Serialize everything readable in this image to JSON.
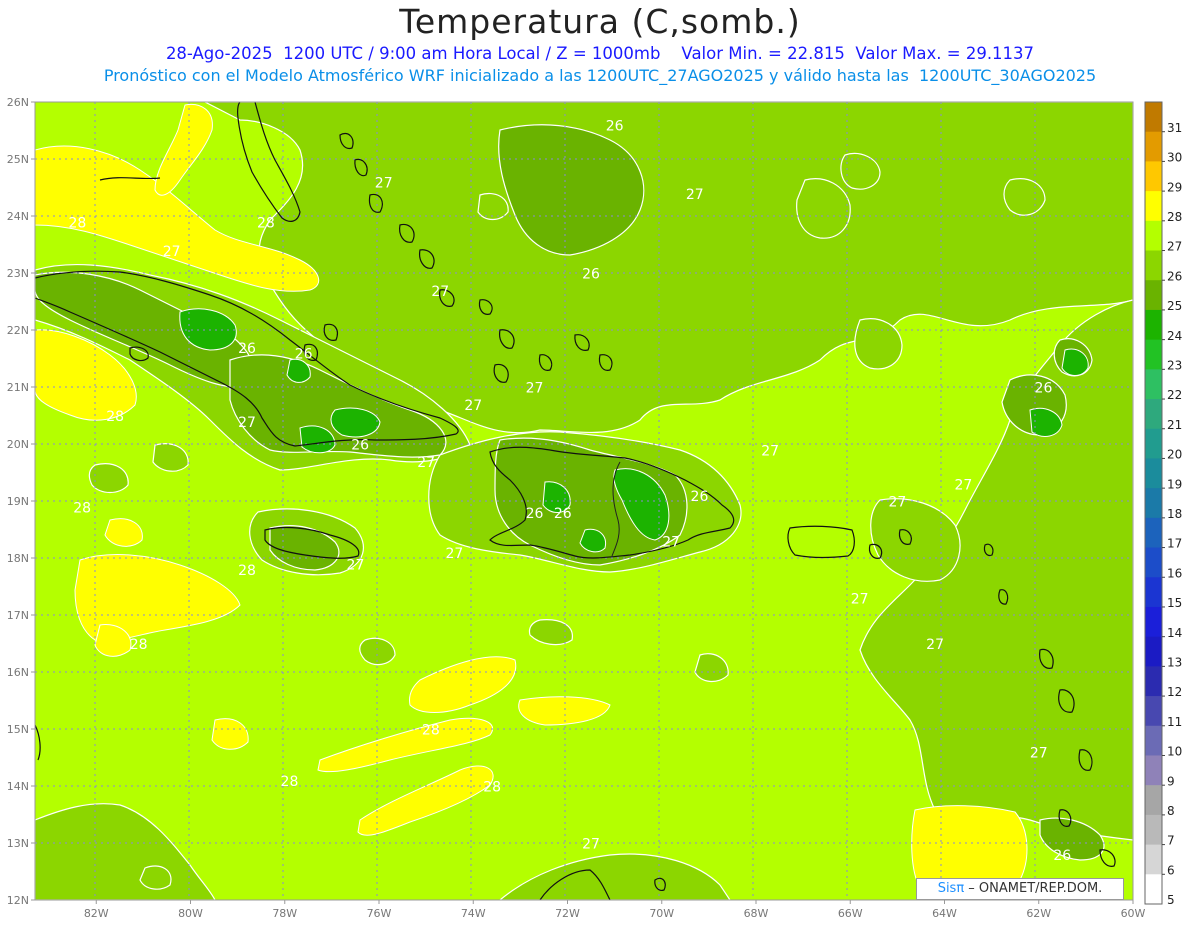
{
  "header": {
    "title": "Temperatura (C,somb.)",
    "line1": "28-Ago-2025  1200 UTC / 9:00 am Hora Local / Z = 1000mb    Valor Min. = 22.815  Valor Max. = 29.1137",
    "line2": "Pronóstico con el Modelo Atmosférico WRF inicializado a las 1200UTC_27AGO2025 y válido hasta las  1200UTC_30AGO2025"
  },
  "axes": {
    "lat_labels": [
      "26N",
      "25N",
      "24N",
      "23N",
      "22N",
      "21N",
      "20N",
      "19N",
      "18N",
      "17N",
      "16N",
      "15N",
      "14N",
      "13N",
      "12N"
    ],
    "lon_labels": [
      "82W",
      "80W",
      "78W",
      "76W",
      "74W",
      "72W",
      "70W",
      "68W",
      "66W",
      "64W",
      "62W",
      "60W"
    ]
  },
  "colorbar": {
    "levels": [
      "31",
      "30",
      "29",
      "28",
      "27",
      "26",
      "25",
      "24",
      "23",
      "22",
      "21",
      "20",
      "19",
      "18",
      "17",
      "16",
      "15",
      "14",
      "13",
      "12",
      "11",
      "10",
      "9",
      "8",
      "7",
      "6",
      "5"
    ],
    "colors": [
      "#c07a00",
      "#e39b00",
      "#ffc800",
      "#ffff00",
      "#b4ff00",
      "#8cd600",
      "#6ab300",
      "#1cb300",
      "#22c224",
      "#2ec062",
      "#2ea97d",
      "#219c8f",
      "#1b8c9c",
      "#1b7aa8",
      "#1c63bc",
      "#1c4dc9",
      "#1b35d2",
      "#1b1fd9",
      "#1b1bc4",
      "#2b2bb0",
      "#4848b0",
      "#6b6bb5",
      "#8f82b8",
      "#a6a6a6",
      "#b9b9b9",
      "#d6d6d6",
      "#ffffff"
    ]
  },
  "contour_labels": [
    {
      "text": "26",
      "lat": 25.5,
      "lon": -71.0
    },
    {
      "text": "27",
      "lat": 24.5,
      "lon": -75.9
    },
    {
      "text": "27",
      "lat": 24.3,
      "lon": -69.3
    },
    {
      "text": "28",
      "lat": 23.8,
      "lon": -82.4
    },
    {
      "text": "28",
      "lat": 23.8,
      "lon": -78.4
    },
    {
      "text": "27",
      "lat": 23.3,
      "lon": -80.4
    },
    {
      "text": "26",
      "lat": 22.9,
      "lon": -71.5
    },
    {
      "text": "27",
      "lat": 22.6,
      "lon": -74.7
    },
    {
      "text": "26",
      "lat": 21.6,
      "lon": -78.8
    },
    {
      "text": "26",
      "lat": 21.5,
      "lon": -77.6
    },
    {
      "text": "26",
      "lat": 20.9,
      "lon": -61.9
    },
    {
      "text": "27",
      "lat": 20.9,
      "lon": -72.7
    },
    {
      "text": "27",
      "lat": 20.6,
      "lon": -74.0
    },
    {
      "text": "28",
      "lat": 20.4,
      "lon": -81.6
    },
    {
      "text": "27",
      "lat": 20.3,
      "lon": -78.8
    },
    {
      "text": "26",
      "lat": 19.9,
      "lon": -76.4
    },
    {
      "text": "27",
      "lat": 19.8,
      "lon": -67.7
    },
    {
      "text": "27",
      "lat": 19.6,
      "lon": -75.0
    },
    {
      "text": "26",
      "lat": 19.0,
      "lon": -69.2
    },
    {
      "text": "27",
      "lat": 19.2,
      "lon": -63.6
    },
    {
      "text": "27",
      "lat": 18.9,
      "lon": -65.0
    },
    {
      "text": "28",
      "lat": 18.8,
      "lon": -82.3
    },
    {
      "text": "26",
      "lat": 18.7,
      "lon": -72.7
    },
    {
      "text": "26",
      "lat": 18.7,
      "lon": -72.1
    },
    {
      "text": "27",
      "lat": 18.2,
      "lon": -69.8
    },
    {
      "text": "27",
      "lat": 18.0,
      "lon": -74.4
    },
    {
      "text": "27",
      "lat": 17.8,
      "lon": -76.5
    },
    {
      "text": "28",
      "lat": 17.7,
      "lon": -78.8
    },
    {
      "text": "27",
      "lat": 17.2,
      "lon": -65.8
    },
    {
      "text": "28",
      "lat": 16.4,
      "lon": -81.1
    },
    {
      "text": "27",
      "lat": 16.4,
      "lon": -64.2
    },
    {
      "text": "28",
      "lat": 14.9,
      "lon": -74.9
    },
    {
      "text": "27",
      "lat": 14.5,
      "lon": -62.0
    },
    {
      "text": "28",
      "lat": 14.0,
      "lon": -77.9
    },
    {
      "text": "28",
      "lat": 13.9,
      "lon": -73.6
    },
    {
      "text": "27",
      "lat": 12.9,
      "lon": -71.5
    },
    {
      "text": "26",
      "lat": 12.7,
      "lon": -61.5
    }
  ],
  "credit": {
    "sis": "Sisπ",
    "org": " – ONAMET/REP.DOM."
  }
}
